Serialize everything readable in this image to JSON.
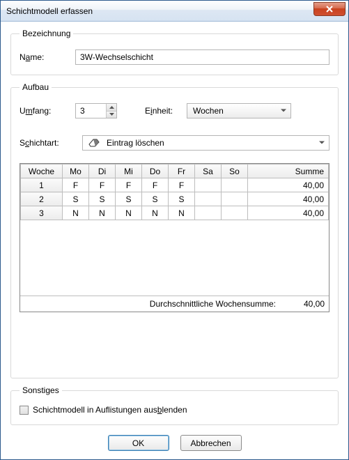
{
  "window": {
    "title": "Schichtmodell erfassen"
  },
  "bezeichnung": {
    "legend": "Bezeichnung",
    "name_label_pre": "N",
    "name_label_mid": "a",
    "name_label_post": "me:",
    "name_value": "3W-Wechselschicht"
  },
  "aufbau": {
    "legend": "Aufbau",
    "umfang_pre": "U",
    "umfang_mid": "m",
    "umfang_post": "fang:",
    "umfang_value": "3",
    "einheit_pre": "E",
    "einheit_mid": "i",
    "einheit_post": "nheit:",
    "einheit_value": "Wochen",
    "schichtart_pre": "S",
    "schichtart_mid": "c",
    "schichtart_post": "hichtart:",
    "schichtart_value": "Eintrag löschen"
  },
  "table": {
    "headers": {
      "woche": "Woche",
      "mo": "Mo",
      "di": "Di",
      "mi": "Mi",
      "do": "Do",
      "fr": "Fr",
      "sa": "Sa",
      "so": "So",
      "summe": "Summe"
    },
    "rows": [
      {
        "woche": "1",
        "mo": "F",
        "di": "F",
        "mi": "F",
        "do": "F",
        "fr": "F",
        "sa": "",
        "so": "",
        "summe": "40,00"
      },
      {
        "woche": "2",
        "mo": "S",
        "di": "S",
        "mi": "S",
        "do": "S",
        "fr": "S",
        "sa": "",
        "so": "",
        "summe": "40,00"
      },
      {
        "woche": "3",
        "mo": "N",
        "di": "N",
        "mi": "N",
        "do": "N",
        "fr": "N",
        "sa": "",
        "so": "",
        "summe": "40,00"
      }
    ],
    "avg_label": "Durchschnittliche Wochensumme:",
    "avg_value": "40,00"
  },
  "sonstiges": {
    "legend": "Sonstiges",
    "hide_pre": "Schichtmodell in Auflistungen aus",
    "hide_mid": "b",
    "hide_post": "lenden"
  },
  "buttons": {
    "ok": "OK",
    "cancel": "Abbrechen"
  }
}
